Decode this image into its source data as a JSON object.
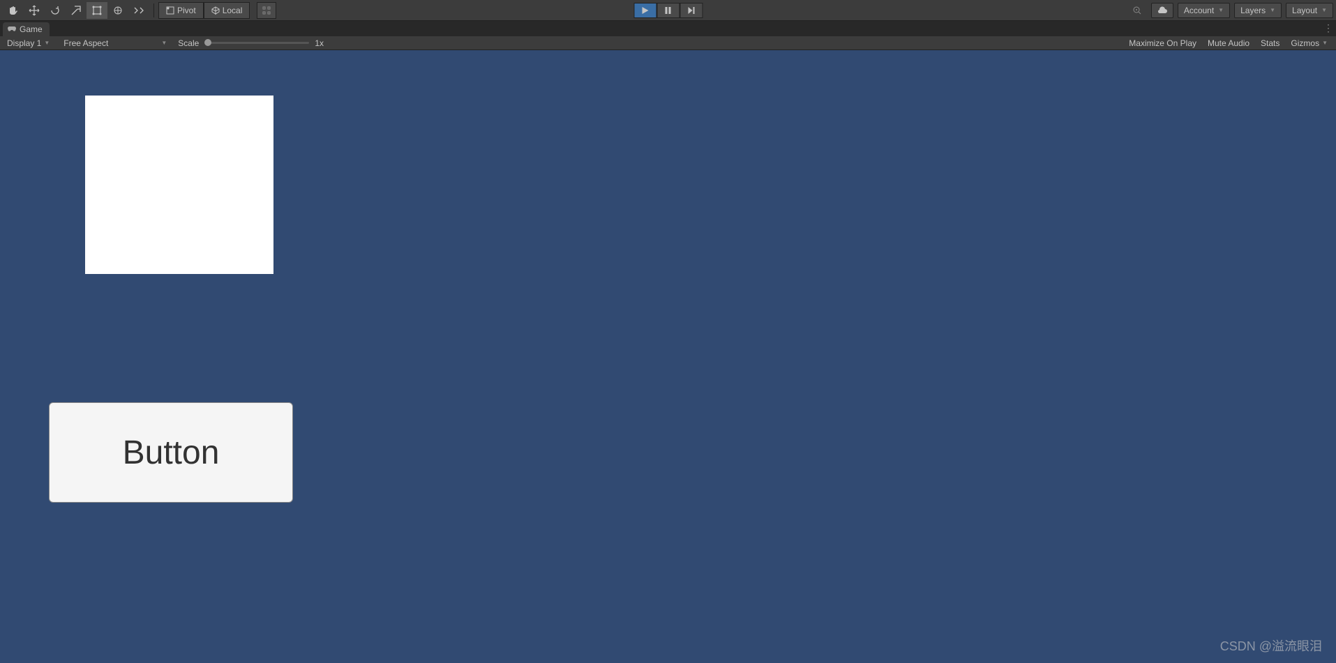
{
  "toolbar": {
    "pivot": "Pivot",
    "local": "Local",
    "account": "Account",
    "layers": "Layers",
    "layout": "Layout"
  },
  "tab": {
    "game": "Game"
  },
  "gameToolbar": {
    "display": "Display 1",
    "aspect": "Free Aspect",
    "scaleLabel": "Scale",
    "scaleValue": "1x",
    "maximize": "Maximize On Play",
    "muteAudio": "Mute Audio",
    "stats": "Stats",
    "gizmos": "Gizmos"
  },
  "gameView": {
    "buttonLabel": "Button"
  },
  "watermark": "CSDN @溢流眼泪"
}
